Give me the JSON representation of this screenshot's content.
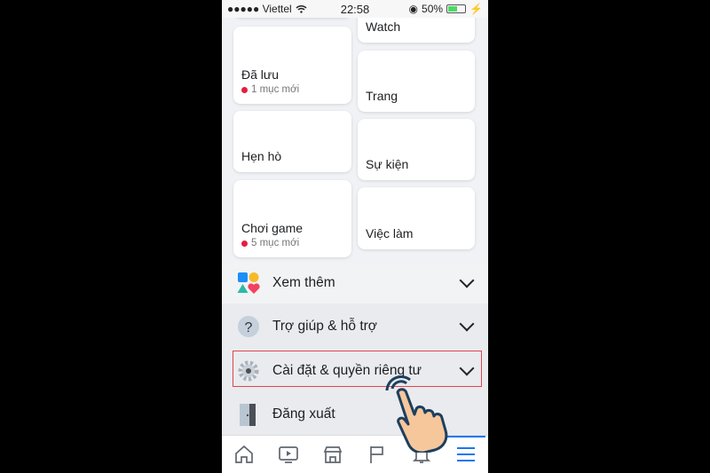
{
  "status_bar": {
    "carrier": "●●●●● Viettel",
    "time": "22:58",
    "battery": "50%",
    "battery_level": 0.5
  },
  "shortcuts": [
    {
      "label": "Watch"
    },
    {
      "label": "Đã lưu",
      "badge": "1 mục mới"
    },
    {
      "label": "Trang"
    },
    {
      "label": "Hẹn hò"
    },
    {
      "label": "Sự kiện"
    },
    {
      "label": "Chơi game",
      "badge": "5 mục mới"
    },
    {
      "label": "Việc làm"
    }
  ],
  "menu": [
    {
      "label": "Xem thêm",
      "icon": "apps-icon"
    },
    {
      "label": "Trợ giúp & hỗ trợ",
      "icon": "help-icon"
    },
    {
      "label": "Cài đặt & quyền riêng tư",
      "icon": "gear-icon",
      "highlighted": true
    },
    {
      "label": "Đăng xuất",
      "icon": "logout-door-icon"
    }
  ],
  "tab_bar": {
    "icons": [
      "home-icon",
      "watch-icon",
      "marketplace-icon",
      "pages-flag-icon",
      "notifications-bell-icon",
      "menu-icon"
    ],
    "active": "menu-icon"
  },
  "colors": {
    "highlight_border": "#e0454f",
    "active_tab": "#1877f2",
    "badge_dot": "#e41e3f"
  }
}
